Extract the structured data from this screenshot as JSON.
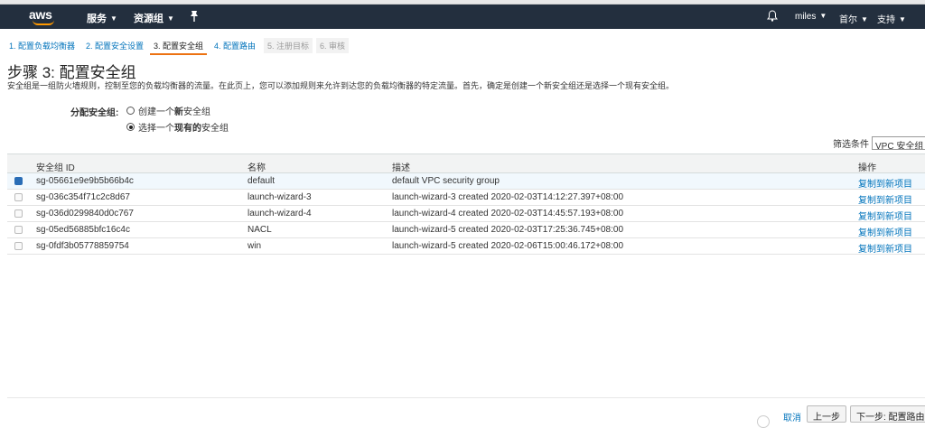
{
  "nav": {
    "logo": "aws",
    "services": "服务",
    "resource_groups": "资源组",
    "user": "miles",
    "region": "首尔",
    "support": "支持"
  },
  "steps": [
    {
      "label": "1. 配置负载均衡器",
      "state": "link"
    },
    {
      "label": "2. 配置安全设置",
      "state": "link"
    },
    {
      "label": "3. 配置安全组",
      "state": "active"
    },
    {
      "label": "4. 配置路由",
      "state": "link"
    },
    {
      "label": "5. 注册目标",
      "state": "disabled"
    },
    {
      "label": "6. 审核",
      "state": "disabled"
    }
  ],
  "page": {
    "title": "步骤 3: 配置安全组",
    "description": "安全组是一组防火墙规则，控制至您的负载均衡器的流量。在此页上，您可以添加规则来允许到达您的负载均衡器的特定流量。首先，确定是创建一个新安全组还是选择一个现有安全组。"
  },
  "assign": {
    "label": "分配安全组:",
    "option_new_prefix": "创建一个",
    "option_new_bold": "新",
    "option_new_suffix": "安全组",
    "option_existing_prefix": "选择一个",
    "option_existing_bold": "现有的",
    "option_existing_suffix": "安全组",
    "selected": "existing"
  },
  "filter": {
    "label": "筛选条件",
    "value": "VPC 安全组"
  },
  "table": {
    "headers": {
      "id": "安全组 ID",
      "name": "名称",
      "desc": "描述",
      "action": "操作"
    },
    "rows": [
      {
        "id": "sg-05661e9e9b5b66b4c",
        "name": "default",
        "desc": "default VPC security group",
        "action": "复制到新项目",
        "checked": true
      },
      {
        "id": "sg-036c354f71c2c8d67",
        "name": "launch-wizard-3",
        "desc": "launch-wizard-3 created 2020-02-03T14:12:27.397+08:00",
        "action": "复制到新项目",
        "checked": false
      },
      {
        "id": "sg-036d0299840d0c767",
        "name": "launch-wizard-4",
        "desc": "launch-wizard-4 created 2020-02-03T14:45:57.193+08:00",
        "action": "复制到新项目",
        "checked": false
      },
      {
        "id": "sg-05ed56885bfc16c4c",
        "name": "NACL",
        "desc": "launch-wizard-5 created 2020-02-03T17:25:36.745+08:00",
        "action": "复制到新项目",
        "checked": false
      },
      {
        "id": "sg-0fdf3b05778859754",
        "name": "win",
        "desc": "launch-wizard-5 created 2020-02-06T15:00:46.172+08:00",
        "action": "复制到新项目",
        "checked": false
      }
    ]
  },
  "footer": {
    "cancel": "取消",
    "prev": "上一步",
    "next": "下一步: 配置路由"
  },
  "colors": {
    "nav_bg": "#232f3e",
    "accent": "#ec7211",
    "link": "#0073bb",
    "logo_smile": "#ff9900"
  }
}
